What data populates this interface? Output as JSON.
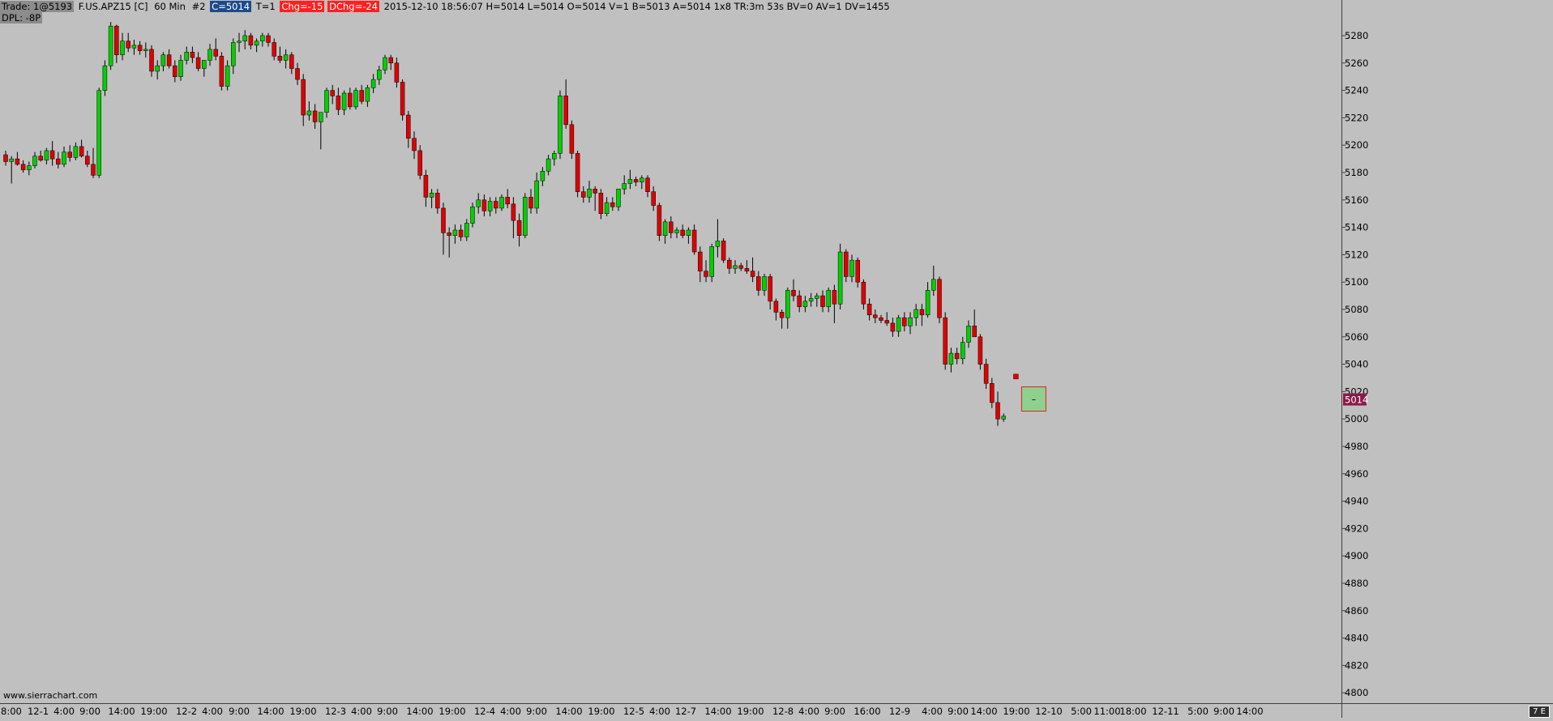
{
  "header": {
    "trade_label": "Trade: 1@5193",
    "symbol": "F.US.APZ15 [C]",
    "timeframe": "60 Min",
    "chart_number": "#2",
    "close": "C=5014",
    "trades": "T=1",
    "change": "Chg=-15",
    "daily_change": "DChg=-24",
    "details": "2015-12-10 18:56:07 H=5014 L=5014 O=5014 V=1 B=5013 A=5014 1x8 TR:3m 53s BV=0 AV=1 DV=1455",
    "dpl": "DPL: -8P"
  },
  "watermark": "www.sierrachart.com",
  "last_price_label": "5014",
  "corner_label": "7 E",
  "current_bar_marker": "–",
  "price_axis": {
    "labels": [
      "5280",
      "5260",
      "5240",
      "5220",
      "5200",
      "5180",
      "5160",
      "5140",
      "5120",
      "5100",
      "5080",
      "5060",
      "5040",
      "5020",
      "5000",
      "4980",
      "4960",
      "4940",
      "4920",
      "4900",
      "4880",
      "4860",
      "4840",
      "4820",
      "4800"
    ]
  },
  "time_axis": {
    "labels": [
      "8:00",
      "12-1",
      "4:00",
      "9:00",
      "14:00",
      "19:00",
      "12-2",
      "4:00",
      "9:00",
      "14:00",
      "19:00",
      "12-3",
      "4:00",
      "9:00",
      "14:00",
      "19:00",
      "12-4",
      "4:00",
      "9:00",
      "14:00",
      "19:00",
      "12-5",
      "4:00",
      "12-7",
      "14:00",
      "19:00",
      "12-8",
      "4:00",
      "9:00",
      "16:00",
      "12-9",
      "4:00",
      "9:00",
      "14:00",
      "19:00",
      "12-10",
      "5:00",
      "11:00",
      "18:00",
      "12-11",
      "5:00",
      "9:00",
      "14:00"
    ]
  },
  "colors": {
    "background": "#c0c0c0",
    "up_candle": "#00d000",
    "down_candle": "#e00000",
    "wick": "#000000",
    "last_price_bg": "#8b1a4a"
  },
  "chart_data": {
    "type": "candlestick",
    "title": "",
    "symbol": "F.US.APZ15",
    "interval": "60 Min",
    "ylim": [
      4800,
      5290
    ],
    "candles": [
      {
        "o": 5193,
        "h": 5196,
        "l": 5185,
        "c": 5188
      },
      {
        "o": 5188,
        "h": 5192,
        "l": 5172,
        "c": 5190
      },
      {
        "o": 5190,
        "h": 5195,
        "l": 5185,
        "c": 5186
      },
      {
        "o": 5186,
        "h": 5189,
        "l": 5180,
        "c": 5182
      },
      {
        "o": 5182,
        "h": 5188,
        "l": 5178,
        "c": 5185
      },
      {
        "o": 5185,
        "h": 5195,
        "l": 5183,
        "c": 5192
      },
      {
        "o": 5192,
        "h": 5196,
        "l": 5188,
        "c": 5189
      },
      {
        "o": 5189,
        "h": 5198,
        "l": 5186,
        "c": 5196
      },
      {
        "o": 5196,
        "h": 5203,
        "l": 5185,
        "c": 5190
      },
      {
        "o": 5190,
        "h": 5195,
        "l": 5183,
        "c": 5186
      },
      {
        "o": 5186,
        "h": 5199,
        "l": 5184,
        "c": 5195
      },
      {
        "o": 5195,
        "h": 5200,
        "l": 5188,
        "c": 5191
      },
      {
        "o": 5191,
        "h": 5202,
        "l": 5189,
        "c": 5199
      },
      {
        "o": 5199,
        "h": 5204,
        "l": 5191,
        "c": 5192
      },
      {
        "o": 5192,
        "h": 5196,
        "l": 5184,
        "c": 5186
      },
      {
        "o": 5186,
        "h": 5198,
        "l": 5176,
        "c": 5178
      },
      {
        "o": 5178,
        "h": 5242,
        "l": 5176,
        "c": 5240
      },
      {
        "o": 5240,
        "h": 5262,
        "l": 5236,
        "c": 5258
      },
      {
        "o": 5258,
        "h": 5290,
        "l": 5255,
        "c": 5287
      },
      {
        "o": 5287,
        "h": 5288,
        "l": 5260,
        "c": 5266
      },
      {
        "o": 5266,
        "h": 5282,
        "l": 5262,
        "c": 5276
      },
      {
        "o": 5276,
        "h": 5282,
        "l": 5268,
        "c": 5271
      },
      {
        "o": 5271,
        "h": 5277,
        "l": 5266,
        "c": 5273
      },
      {
        "o": 5273,
        "h": 5276,
        "l": 5266,
        "c": 5269
      },
      {
        "o": 5269,
        "h": 5275,
        "l": 5264,
        "c": 5270
      },
      {
        "o": 5270,
        "h": 5273,
        "l": 5250,
        "c": 5254
      },
      {
        "o": 5254,
        "h": 5262,
        "l": 5248,
        "c": 5258
      },
      {
        "o": 5258,
        "h": 5268,
        "l": 5254,
        "c": 5266
      },
      {
        "o": 5266,
        "h": 5270,
        "l": 5256,
        "c": 5258
      },
      {
        "o": 5258,
        "h": 5262,
        "l": 5246,
        "c": 5250
      },
      {
        "o": 5250,
        "h": 5266,
        "l": 5247,
        "c": 5262
      },
      {
        "o": 5262,
        "h": 5272,
        "l": 5259,
        "c": 5268
      },
      {
        "o": 5268,
        "h": 5272,
        "l": 5260,
        "c": 5264
      },
      {
        "o": 5264,
        "h": 5268,
        "l": 5254,
        "c": 5256
      },
      {
        "o": 5256,
        "h": 5262,
        "l": 5250,
        "c": 5262
      },
      {
        "o": 5262,
        "h": 5274,
        "l": 5258,
        "c": 5270
      },
      {
        "o": 5270,
        "h": 5278,
        "l": 5262,
        "c": 5265
      },
      {
        "o": 5265,
        "h": 5268,
        "l": 5240,
        "c": 5243
      },
      {
        "o": 5243,
        "h": 5262,
        "l": 5240,
        "c": 5258
      },
      {
        "o": 5258,
        "h": 5278,
        "l": 5252,
        "c": 5275
      },
      {
        "o": 5275,
        "h": 5282,
        "l": 5268,
        "c": 5276
      },
      {
        "o": 5276,
        "h": 5284,
        "l": 5270,
        "c": 5280
      },
      {
        "o": 5280,
        "h": 5282,
        "l": 5270,
        "c": 5273
      },
      {
        "o": 5273,
        "h": 5278,
        "l": 5268,
        "c": 5276
      },
      {
        "o": 5276,
        "h": 5282,
        "l": 5272,
        "c": 5280
      },
      {
        "o": 5280,
        "h": 5282,
        "l": 5272,
        "c": 5275
      },
      {
        "o": 5275,
        "h": 5278,
        "l": 5262,
        "c": 5265
      },
      {
        "o": 5265,
        "h": 5272,
        "l": 5260,
        "c": 5262
      },
      {
        "o": 5262,
        "h": 5270,
        "l": 5256,
        "c": 5266
      },
      {
        "o": 5266,
        "h": 5268,
        "l": 5252,
        "c": 5256
      },
      {
        "o": 5256,
        "h": 5260,
        "l": 5244,
        "c": 5248
      },
      {
        "o": 5248,
        "h": 5252,
        "l": 5214,
        "c": 5222
      },
      {
        "o": 5222,
        "h": 5232,
        "l": 5218,
        "c": 5225
      },
      {
        "o": 5225,
        "h": 5230,
        "l": 5212,
        "c": 5217
      },
      {
        "o": 5217,
        "h": 5220,
        "l": 5197,
        "c": 5224
      },
      {
        "o": 5224,
        "h": 5242,
        "l": 5220,
        "c": 5240
      },
      {
        "o": 5240,
        "h": 5244,
        "l": 5230,
        "c": 5236
      },
      {
        "o": 5236,
        "h": 5242,
        "l": 5222,
        "c": 5226
      },
      {
        "o": 5226,
        "h": 5240,
        "l": 5222,
        "c": 5238
      },
      {
        "o": 5238,
        "h": 5242,
        "l": 5226,
        "c": 5228
      },
      {
        "o": 5228,
        "h": 5242,
        "l": 5226,
        "c": 5240
      },
      {
        "o": 5240,
        "h": 5244,
        "l": 5230,
        "c": 5232
      },
      {
        "o": 5232,
        "h": 5244,
        "l": 5228,
        "c": 5242
      },
      {
        "o": 5242,
        "h": 5252,
        "l": 5238,
        "c": 5248
      },
      {
        "o": 5248,
        "h": 5258,
        "l": 5244,
        "c": 5255
      },
      {
        "o": 5255,
        "h": 5266,
        "l": 5252,
        "c": 5264
      },
      {
        "o": 5264,
        "h": 5266,
        "l": 5255,
        "c": 5260
      },
      {
        "o": 5260,
        "h": 5264,
        "l": 5242,
        "c": 5246
      },
      {
        "o": 5246,
        "h": 5248,
        "l": 5218,
        "c": 5222
      },
      {
        "o": 5222,
        "h": 5225,
        "l": 5198,
        "c": 5205
      },
      {
        "o": 5205,
        "h": 5210,
        "l": 5190,
        "c": 5196
      },
      {
        "o": 5196,
        "h": 5200,
        "l": 5175,
        "c": 5178
      },
      {
        "o": 5178,
        "h": 5182,
        "l": 5155,
        "c": 5162
      },
      {
        "o": 5162,
        "h": 5168,
        "l": 5154,
        "c": 5165
      },
      {
        "o": 5165,
        "h": 5168,
        "l": 5150,
        "c": 5154
      },
      {
        "o": 5154,
        "h": 5158,
        "l": 5120,
        "c": 5136
      },
      {
        "o": 5136,
        "h": 5140,
        "l": 5118,
        "c": 5134
      },
      {
        "o": 5134,
        "h": 5142,
        "l": 5128,
        "c": 5138
      },
      {
        "o": 5138,
        "h": 5142,
        "l": 5130,
        "c": 5133
      },
      {
        "o": 5133,
        "h": 5146,
        "l": 5130,
        "c": 5143
      },
      {
        "o": 5143,
        "h": 5158,
        "l": 5140,
        "c": 5155
      },
      {
        "o": 5155,
        "h": 5165,
        "l": 5150,
        "c": 5160
      },
      {
        "o": 5160,
        "h": 5164,
        "l": 5148,
        "c": 5152
      },
      {
        "o": 5152,
        "h": 5162,
        "l": 5148,
        "c": 5159
      },
      {
        "o": 5159,
        "h": 5162,
        "l": 5150,
        "c": 5154
      },
      {
        "o": 5154,
        "h": 5164,
        "l": 5152,
        "c": 5162
      },
      {
        "o": 5162,
        "h": 5168,
        "l": 5154,
        "c": 5157
      },
      {
        "o": 5157,
        "h": 5162,
        "l": 5132,
        "c": 5145
      },
      {
        "o": 5145,
        "h": 5150,
        "l": 5126,
        "c": 5134
      },
      {
        "o": 5134,
        "h": 5165,
        "l": 5132,
        "c": 5162
      },
      {
        "o": 5162,
        "h": 5168,
        "l": 5150,
        "c": 5154
      },
      {
        "o": 5154,
        "h": 5180,
        "l": 5150,
        "c": 5174
      },
      {
        "o": 5174,
        "h": 5184,
        "l": 5170,
        "c": 5181
      },
      {
        "o": 5181,
        "h": 5193,
        "l": 5178,
        "c": 5190
      },
      {
        "o": 5190,
        "h": 5196,
        "l": 5185,
        "c": 5194
      },
      {
        "o": 5194,
        "h": 5240,
        "l": 5190,
        "c": 5236
      },
      {
        "o": 5236,
        "h": 5248,
        "l": 5212,
        "c": 5215
      },
      {
        "o": 5215,
        "h": 5218,
        "l": 5190,
        "c": 5194
      },
      {
        "o": 5194,
        "h": 5196,
        "l": 5162,
        "c": 5166
      },
      {
        "o": 5166,
        "h": 5170,
        "l": 5158,
        "c": 5162
      },
      {
        "o": 5162,
        "h": 5174,
        "l": 5158,
        "c": 5168
      },
      {
        "o": 5168,
        "h": 5170,
        "l": 5152,
        "c": 5165
      },
      {
        "o": 5165,
        "h": 5168,
        "l": 5146,
        "c": 5150
      },
      {
        "o": 5150,
        "h": 5162,
        "l": 5148,
        "c": 5158
      },
      {
        "o": 5158,
        "h": 5162,
        "l": 5152,
        "c": 5155
      },
      {
        "o": 5155,
        "h": 5166,
        "l": 5152,
        "c": 5168
      },
      {
        "o": 5168,
        "h": 5178,
        "l": 5164,
        "c": 5172
      },
      {
        "o": 5172,
        "h": 5182,
        "l": 5168,
        "c": 5175
      },
      {
        "o": 5175,
        "h": 5177,
        "l": 5170,
        "c": 5173
      },
      {
        "o": 5173,
        "h": 5178,
        "l": 5168,
        "c": 5176
      },
      {
        "o": 5176,
        "h": 5178,
        "l": 5162,
        "c": 5166
      },
      {
        "o": 5166,
        "h": 5170,
        "l": 5152,
        "c": 5156
      },
      {
        "o": 5156,
        "h": 5158,
        "l": 5130,
        "c": 5134
      },
      {
        "o": 5134,
        "h": 5146,
        "l": 5128,
        "c": 5144
      },
      {
        "o": 5144,
        "h": 5148,
        "l": 5132,
        "c": 5136
      },
      {
        "o": 5136,
        "h": 5140,
        "l": 5132,
        "c": 5138
      },
      {
        "o": 5138,
        "h": 5142,
        "l": 5132,
        "c": 5134
      },
      {
        "o": 5134,
        "h": 5140,
        "l": 5128,
        "c": 5138
      },
      {
        "o": 5138,
        "h": 5142,
        "l": 5120,
        "c": 5122
      },
      {
        "o": 5122,
        "h": 5126,
        "l": 5100,
        "c": 5108
      },
      {
        "o": 5108,
        "h": 5116,
        "l": 5100,
        "c": 5104
      },
      {
        "o": 5104,
        "h": 5128,
        "l": 5100,
        "c": 5126
      },
      {
        "o": 5126,
        "h": 5146,
        "l": 5118,
        "c": 5130
      },
      {
        "o": 5130,
        "h": 5132,
        "l": 5114,
        "c": 5116
      },
      {
        "o": 5116,
        "h": 5118,
        "l": 5106,
        "c": 5110
      },
      {
        "o": 5110,
        "h": 5116,
        "l": 5106,
        "c": 5112
      },
      {
        "o": 5112,
        "h": 5114,
        "l": 5108,
        "c": 5110
      },
      {
        "o": 5110,
        "h": 5116,
        "l": 5106,
        "c": 5108
      },
      {
        "o": 5108,
        "h": 5118,
        "l": 5100,
        "c": 5104
      },
      {
        "o": 5104,
        "h": 5108,
        "l": 5090,
        "c": 5094
      },
      {
        "o": 5094,
        "h": 5106,
        "l": 5090,
        "c": 5104
      },
      {
        "o": 5104,
        "h": 5106,
        "l": 5080,
        "c": 5086
      },
      {
        "o": 5086,
        "h": 5088,
        "l": 5072,
        "c": 5078
      },
      {
        "o": 5078,
        "h": 5080,
        "l": 5066,
        "c": 5074
      },
      {
        "o": 5074,
        "h": 5096,
        "l": 5066,
        "c": 5094
      },
      {
        "o": 5094,
        "h": 5102,
        "l": 5086,
        "c": 5090
      },
      {
        "o": 5090,
        "h": 5094,
        "l": 5078,
        "c": 5082
      },
      {
        "o": 5082,
        "h": 5090,
        "l": 5078,
        "c": 5086
      },
      {
        "o": 5086,
        "h": 5092,
        "l": 5082,
        "c": 5088
      },
      {
        "o": 5088,
        "h": 5092,
        "l": 5082,
        "c": 5090
      },
      {
        "o": 5090,
        "h": 5094,
        "l": 5078,
        "c": 5082
      },
      {
        "o": 5082,
        "h": 5096,
        "l": 5078,
        "c": 5094
      },
      {
        "o": 5094,
        "h": 5098,
        "l": 5070,
        "c": 5084
      },
      {
        "o": 5084,
        "h": 5128,
        "l": 5080,
        "c": 5122
      },
      {
        "o": 5122,
        "h": 5124,
        "l": 5100,
        "c": 5104
      },
      {
        "o": 5104,
        "h": 5120,
        "l": 5100,
        "c": 5116
      },
      {
        "o": 5116,
        "h": 5118,
        "l": 5096,
        "c": 5100
      },
      {
        "o": 5100,
        "h": 5102,
        "l": 5080,
        "c": 5084
      },
      {
        "o": 5084,
        "h": 5088,
        "l": 5072,
        "c": 5076
      },
      {
        "o": 5076,
        "h": 5080,
        "l": 5070,
        "c": 5074
      },
      {
        "o": 5074,
        "h": 5076,
        "l": 5070,
        "c": 5072
      },
      {
        "o": 5072,
        "h": 5078,
        "l": 5068,
        "c": 5070
      },
      {
        "o": 5070,
        "h": 5074,
        "l": 5060,
        "c": 5064
      },
      {
        "o": 5064,
        "h": 5076,
        "l": 5060,
        "c": 5074
      },
      {
        "o": 5074,
        "h": 5078,
        "l": 5064,
        "c": 5068
      },
      {
        "o": 5068,
        "h": 5078,
        "l": 5062,
        "c": 5074
      },
      {
        "o": 5074,
        "h": 5084,
        "l": 5068,
        "c": 5080
      },
      {
        "o": 5080,
        "h": 5084,
        "l": 5068,
        "c": 5076
      },
      {
        "o": 5076,
        "h": 5100,
        "l": 5074,
        "c": 5094
      },
      {
        "o": 5094,
        "h": 5112,
        "l": 5090,
        "c": 5102
      },
      {
        "o": 5102,
        "h": 5104,
        "l": 5070,
        "c": 5074
      },
      {
        "o": 5074,
        "h": 5078,
        "l": 5036,
        "c": 5040
      },
      {
        "o": 5040,
        "h": 5052,
        "l": 5034,
        "c": 5048
      },
      {
        "o": 5048,
        "h": 5052,
        "l": 5040,
        "c": 5044
      },
      {
        "o": 5044,
        "h": 5060,
        "l": 5040,
        "c": 5056
      },
      {
        "o": 5056,
        "h": 5072,
        "l": 5052,
        "c": 5068
      },
      {
        "o": 5068,
        "h": 5080,
        "l": 5062,
        "c": 5060
      },
      {
        "o": 5060,
        "h": 5062,
        "l": 5036,
        "c": 5040
      },
      {
        "o": 5040,
        "h": 5044,
        "l": 5022,
        "c": 5026
      },
      {
        "o": 5026,
        "h": 5030,
        "l": 5008,
        "c": 5012
      },
      {
        "o": 5012,
        "h": 5020,
        "l": 4995,
        "c": 5000
      },
      {
        "o": 5000,
        "h": 5004,
        "l": 4998,
        "c": 5002
      }
    ],
    "last_price": 5014,
    "trade_marker_price": 5031
  }
}
